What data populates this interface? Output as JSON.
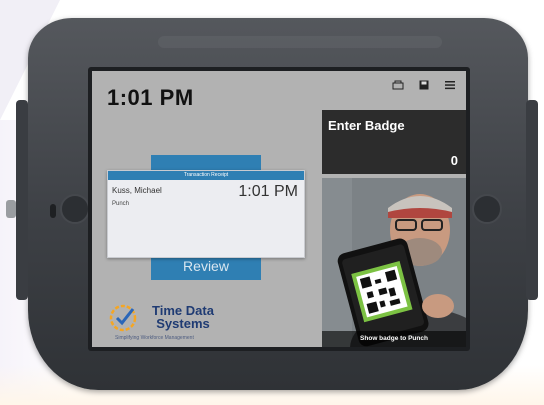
{
  "screen": {
    "clock": "1:01 PM",
    "top_icons": [
      "printer-icon",
      "save-icon",
      "menu-icon"
    ]
  },
  "badge": {
    "title": "Enter Badge",
    "value": "0"
  },
  "camera": {
    "caption": "Show badge to Punch"
  },
  "receipt": {
    "header": "Transaction Receipt",
    "name": "Kuss, Michael",
    "time": "1:01 PM",
    "type": "Punch"
  },
  "review": {
    "label": "Review"
  },
  "logo": {
    "name_line1": "Time Data",
    "name_line2": "Systems",
    "tagline": "Simplifying Workforce Management"
  },
  "colors": {
    "accent": "#2f7fb3",
    "brand": "#1f3b73",
    "panel_dark": "#2c2c2c",
    "screen_bg": "#b2b2b2"
  }
}
